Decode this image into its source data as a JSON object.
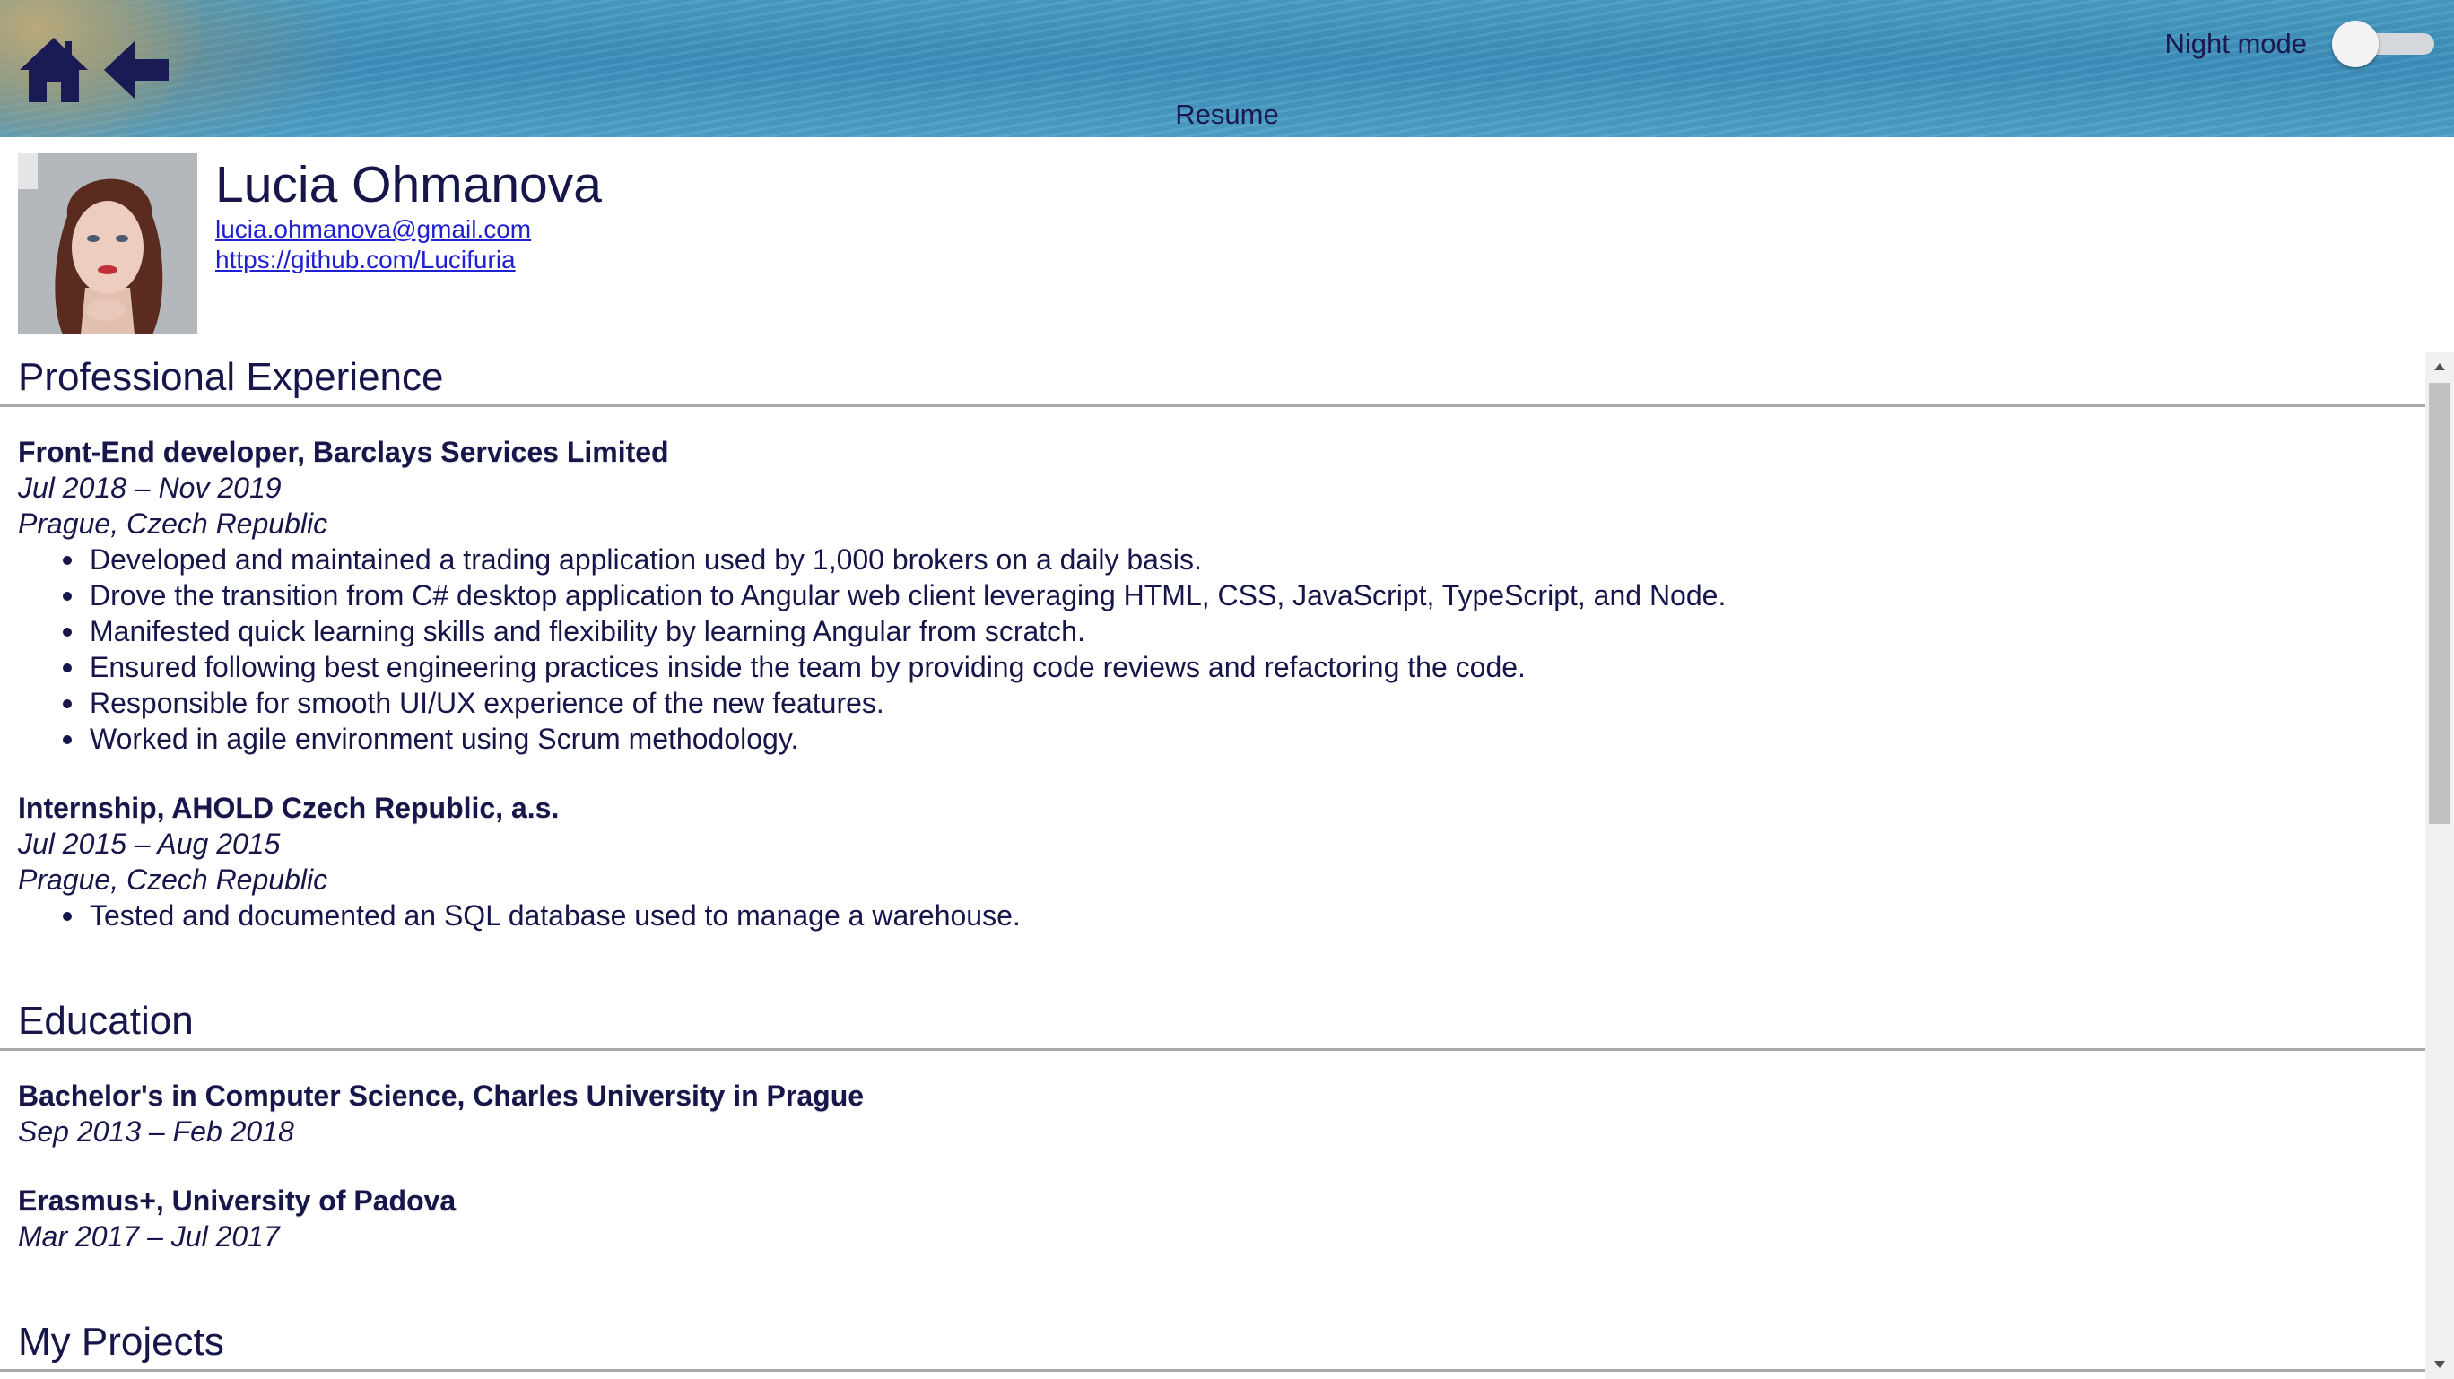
{
  "header": {
    "page_label": "Resume",
    "night_mode_label": "Night mode",
    "night_mode_on": false,
    "icons": [
      "home-icon",
      "back-arrow-icon"
    ]
  },
  "profile": {
    "name": "Lucia Ohmanova",
    "email": "lucia.ohmanova@gmail.com",
    "github": "https://github.com/Lucifuria"
  },
  "experience": {
    "title": "Professional Experience",
    "entries": [
      {
        "title": "Front-End developer, Barclays Services Limited",
        "dates": "Jul 2018 – Nov 2019",
        "location": "Prague, Czech Republic",
        "bullets": [
          "Developed and maintained a trading application used by 1,000 brokers on a daily basis.",
          "Drove the transition from C# desktop application to Angular web client leveraging HTML, CSS, JavaScript, TypeScript, and Node.",
          "Manifested quick learning skills and flexibility by learning Angular from scratch.",
          "Ensured following best engineering practices inside the team by providing code reviews and refactoring the code.",
          "Responsible for smooth UI/UX experience of the new features.",
          "Worked in agile environment using Scrum methodology."
        ]
      },
      {
        "title": "Internship, AHOLD Czech Republic, a.s.",
        "dates": "Jul 2015 – Aug 2015",
        "location": "Prague, Czech Republic",
        "bullets": [
          "Tested and documented an SQL database used to manage a warehouse."
        ]
      }
    ]
  },
  "education": {
    "title": "Education",
    "entries": [
      {
        "title": "Bachelor's in Computer Science, Charles University in Prague",
        "dates": "Sep 2013 – Feb 2018"
      },
      {
        "title": "Erasmus+, University of Padova",
        "dates": "Mar 2017 – Jul 2017"
      }
    ]
  },
  "projects": {
    "title": "My Projects"
  },
  "colors": {
    "text": "#16164a",
    "link": "#2020d0",
    "rule": "#a8a8a8",
    "header_water": "#3d8fbc"
  }
}
